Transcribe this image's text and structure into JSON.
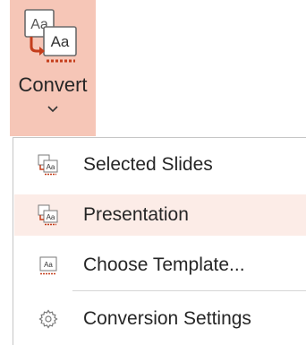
{
  "ribbon": {
    "convert_label": "Convert",
    "button_icon": "convert-icon",
    "icon_glyph_back": "Aa",
    "icon_glyph_front": "Aa",
    "accent_color": "#f6c6b7"
  },
  "menu": {
    "items": [
      {
        "label": "Selected Slides",
        "icon": "selected-slides-icon",
        "glyph": "Aa",
        "highlighted": false
      },
      {
        "label": "Presentation",
        "icon": "presentation-icon",
        "glyph": "Aa",
        "highlighted": true
      },
      {
        "label": "Choose Template...",
        "icon": "choose-template-icon",
        "glyph": "Aa",
        "highlighted": false
      },
      {
        "label": "Conversion Settings",
        "icon": "gear-icon",
        "highlighted": false
      }
    ],
    "hover_color": "#fcece7"
  }
}
